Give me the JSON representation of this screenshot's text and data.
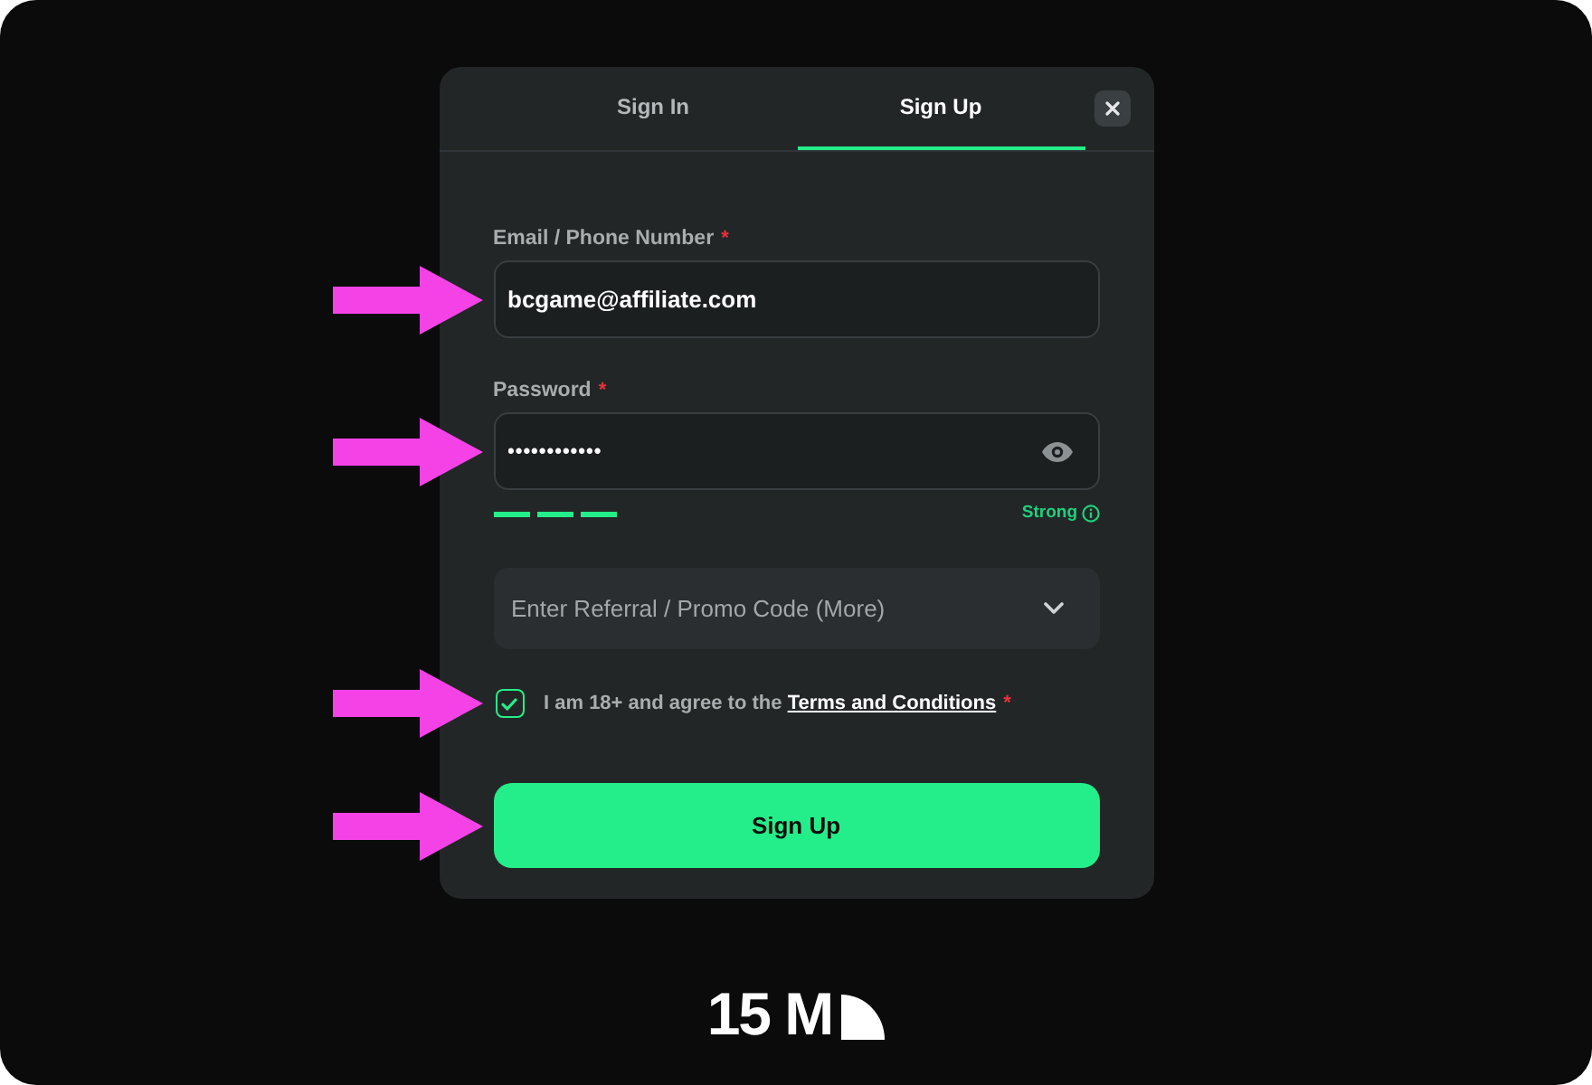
{
  "tabs": [
    {
      "label": "Sign In",
      "selected": false
    },
    {
      "label": "Sign Up",
      "selected": true
    }
  ],
  "form": {
    "fields": [
      {
        "kind": "text",
        "label": "Email / Phone Number",
        "required_mark": "*",
        "value": "bcgame@affiliate.com",
        "highlight_arrow": true
      },
      {
        "kind": "password",
        "label": "Password",
        "required_mark": "*",
        "value": "••••••••••••",
        "highlight_arrow": true,
        "strength": {
          "level": 1,
          "label": "Strong"
        }
      }
    ],
    "promo": {
      "label": "Enter Referral / Promo Code (More)",
      "expanded": false
    },
    "terms": {
      "checked": true,
      "text": "I am 18+ and agree to the",
      "link": "Terms and Conditions",
      "required_mark": "*",
      "highlight_arrow": true
    },
    "submit": {
      "label": "Sign Up",
      "highlight_arrow": true
    }
  },
  "logo": {
    "text": "15 M"
  }
}
